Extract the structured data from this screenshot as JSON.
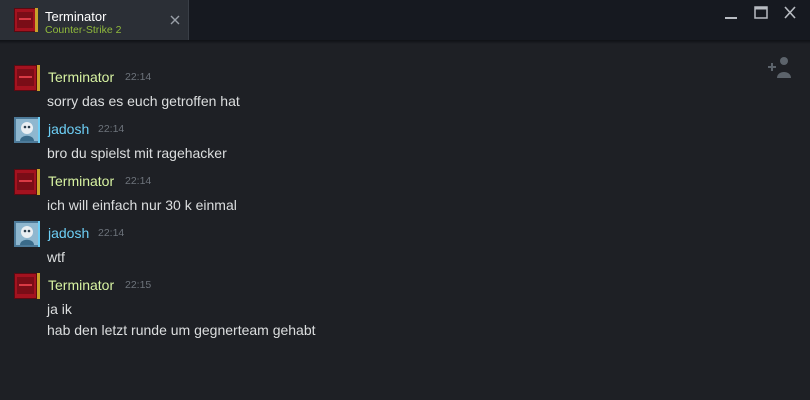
{
  "window": {
    "tab": {
      "title": "Terminator",
      "subtitle": "Counter-Strike 2",
      "avatar_icon": "terminator-avatar"
    },
    "controls": [
      "minimize",
      "maximize",
      "close"
    ]
  },
  "colors": {
    "ingame_name": "#d8f3a2",
    "online_name": "#6dcff6",
    "game_subtitle": "#90ba3c",
    "message_text": "#dcdedf",
    "timestamp": "#6d737b",
    "background": "#1e2025"
  },
  "messages": [
    {
      "sender": "Terminator",
      "time": "22:14",
      "status": "ingame",
      "lines": [
        "sorry das es euch getroffen hat"
      ]
    },
    {
      "sender": "jadosh",
      "time": "22:14",
      "status": "online",
      "lines": [
        "bro du spielst mit ragehacker"
      ]
    },
    {
      "sender": "Terminator",
      "time": "22:14",
      "status": "ingame",
      "lines": [
        "ich will einfach nur 30 k einmal"
      ]
    },
    {
      "sender": "jadosh",
      "time": "22:14",
      "status": "online",
      "lines": [
        "wtf"
      ]
    },
    {
      "sender": "Terminator",
      "time": "22:15",
      "status": "ingame",
      "lines": [
        "ja ik",
        "hab den letzt runde um gegnerteam gehabt"
      ]
    }
  ]
}
